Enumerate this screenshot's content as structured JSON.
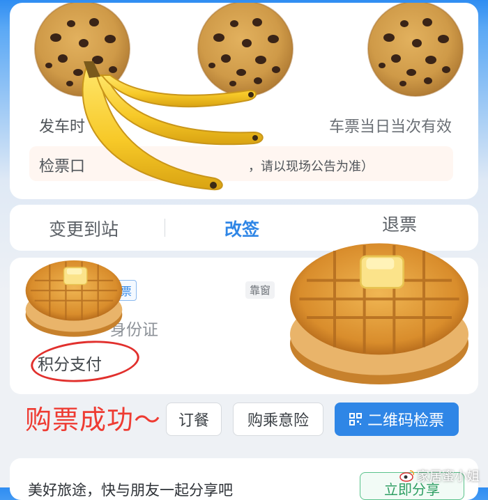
{
  "ticket_card": {
    "departure_label": "发车时",
    "validity_note": "车票当日当次有效",
    "gate_label": "检票口",
    "gate_note": "，请以现场公告为准）"
  },
  "actions": {
    "change_destination": "变更到站",
    "rebook": "改签",
    "refund": "退票"
  },
  "passenger": {
    "ticket_type": "票",
    "seat_note": "靠窗",
    "id_type": "身份证",
    "payment_method": "积分支付"
  },
  "overlay_caption": "购票成功～",
  "buttons": {
    "meal": "订餐",
    "insurance": "购乘意险",
    "qr_check": "二维码检票"
  },
  "share_card": {
    "text": "美好旅途，快与朋友一起分享吧",
    "button": "立即分享"
  },
  "watermark": "家居蜜小姐",
  "stickers": [
    "chocolate-chip-cookie",
    "chocolate-chip-cookie",
    "chocolate-chip-cookie",
    "banana-bunch",
    "waffle-with-butter",
    "waffle-with-butter"
  ],
  "colors": {
    "accent_blue": "#2f86e6",
    "alert_red": "#ee3b32",
    "share_green": "#2f9e63"
  }
}
